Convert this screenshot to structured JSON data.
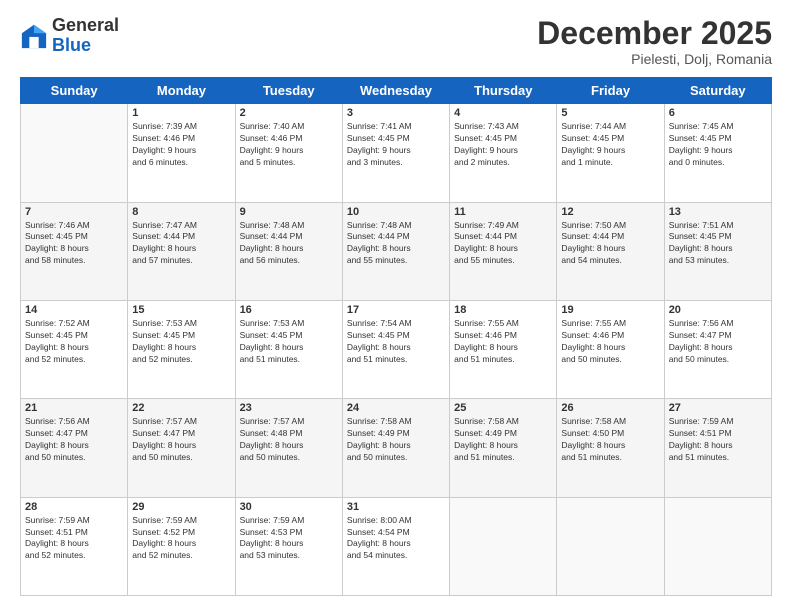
{
  "header": {
    "logo_line1": "General",
    "logo_line2": "Blue",
    "month": "December 2025",
    "location": "Pielesti, Dolj, Romania"
  },
  "weekdays": [
    "Sunday",
    "Monday",
    "Tuesday",
    "Wednesday",
    "Thursday",
    "Friday",
    "Saturday"
  ],
  "weeks": [
    [
      {
        "day": "",
        "info": ""
      },
      {
        "day": "1",
        "info": "Sunrise: 7:39 AM\nSunset: 4:46 PM\nDaylight: 9 hours\nand 6 minutes."
      },
      {
        "day": "2",
        "info": "Sunrise: 7:40 AM\nSunset: 4:46 PM\nDaylight: 9 hours\nand 5 minutes."
      },
      {
        "day": "3",
        "info": "Sunrise: 7:41 AM\nSunset: 4:45 PM\nDaylight: 9 hours\nand 3 minutes."
      },
      {
        "day": "4",
        "info": "Sunrise: 7:43 AM\nSunset: 4:45 PM\nDaylight: 9 hours\nand 2 minutes."
      },
      {
        "day": "5",
        "info": "Sunrise: 7:44 AM\nSunset: 4:45 PM\nDaylight: 9 hours\nand 1 minute."
      },
      {
        "day": "6",
        "info": "Sunrise: 7:45 AM\nSunset: 4:45 PM\nDaylight: 9 hours\nand 0 minutes."
      }
    ],
    [
      {
        "day": "7",
        "info": "Sunrise: 7:46 AM\nSunset: 4:45 PM\nDaylight: 8 hours\nand 58 minutes."
      },
      {
        "day": "8",
        "info": "Sunrise: 7:47 AM\nSunset: 4:44 PM\nDaylight: 8 hours\nand 57 minutes."
      },
      {
        "day": "9",
        "info": "Sunrise: 7:48 AM\nSunset: 4:44 PM\nDaylight: 8 hours\nand 56 minutes."
      },
      {
        "day": "10",
        "info": "Sunrise: 7:48 AM\nSunset: 4:44 PM\nDaylight: 8 hours\nand 55 minutes."
      },
      {
        "day": "11",
        "info": "Sunrise: 7:49 AM\nSunset: 4:44 PM\nDaylight: 8 hours\nand 55 minutes."
      },
      {
        "day": "12",
        "info": "Sunrise: 7:50 AM\nSunset: 4:44 PM\nDaylight: 8 hours\nand 54 minutes."
      },
      {
        "day": "13",
        "info": "Sunrise: 7:51 AM\nSunset: 4:45 PM\nDaylight: 8 hours\nand 53 minutes."
      }
    ],
    [
      {
        "day": "14",
        "info": "Sunrise: 7:52 AM\nSunset: 4:45 PM\nDaylight: 8 hours\nand 52 minutes."
      },
      {
        "day": "15",
        "info": "Sunrise: 7:53 AM\nSunset: 4:45 PM\nDaylight: 8 hours\nand 52 minutes."
      },
      {
        "day": "16",
        "info": "Sunrise: 7:53 AM\nSunset: 4:45 PM\nDaylight: 8 hours\nand 51 minutes."
      },
      {
        "day": "17",
        "info": "Sunrise: 7:54 AM\nSunset: 4:45 PM\nDaylight: 8 hours\nand 51 minutes."
      },
      {
        "day": "18",
        "info": "Sunrise: 7:55 AM\nSunset: 4:46 PM\nDaylight: 8 hours\nand 51 minutes."
      },
      {
        "day": "19",
        "info": "Sunrise: 7:55 AM\nSunset: 4:46 PM\nDaylight: 8 hours\nand 50 minutes."
      },
      {
        "day": "20",
        "info": "Sunrise: 7:56 AM\nSunset: 4:47 PM\nDaylight: 8 hours\nand 50 minutes."
      }
    ],
    [
      {
        "day": "21",
        "info": "Sunrise: 7:56 AM\nSunset: 4:47 PM\nDaylight: 8 hours\nand 50 minutes."
      },
      {
        "day": "22",
        "info": "Sunrise: 7:57 AM\nSunset: 4:47 PM\nDaylight: 8 hours\nand 50 minutes."
      },
      {
        "day": "23",
        "info": "Sunrise: 7:57 AM\nSunset: 4:48 PM\nDaylight: 8 hours\nand 50 minutes."
      },
      {
        "day": "24",
        "info": "Sunrise: 7:58 AM\nSunset: 4:49 PM\nDaylight: 8 hours\nand 50 minutes."
      },
      {
        "day": "25",
        "info": "Sunrise: 7:58 AM\nSunset: 4:49 PM\nDaylight: 8 hours\nand 51 minutes."
      },
      {
        "day": "26",
        "info": "Sunrise: 7:58 AM\nSunset: 4:50 PM\nDaylight: 8 hours\nand 51 minutes."
      },
      {
        "day": "27",
        "info": "Sunrise: 7:59 AM\nSunset: 4:51 PM\nDaylight: 8 hours\nand 51 minutes."
      }
    ],
    [
      {
        "day": "28",
        "info": "Sunrise: 7:59 AM\nSunset: 4:51 PM\nDaylight: 8 hours\nand 52 minutes."
      },
      {
        "day": "29",
        "info": "Sunrise: 7:59 AM\nSunset: 4:52 PM\nDaylight: 8 hours\nand 52 minutes."
      },
      {
        "day": "30",
        "info": "Sunrise: 7:59 AM\nSunset: 4:53 PM\nDaylight: 8 hours\nand 53 minutes."
      },
      {
        "day": "31",
        "info": "Sunrise: 8:00 AM\nSunset: 4:54 PM\nDaylight: 8 hours\nand 54 minutes."
      },
      {
        "day": "",
        "info": ""
      },
      {
        "day": "",
        "info": ""
      },
      {
        "day": "",
        "info": ""
      }
    ]
  ]
}
